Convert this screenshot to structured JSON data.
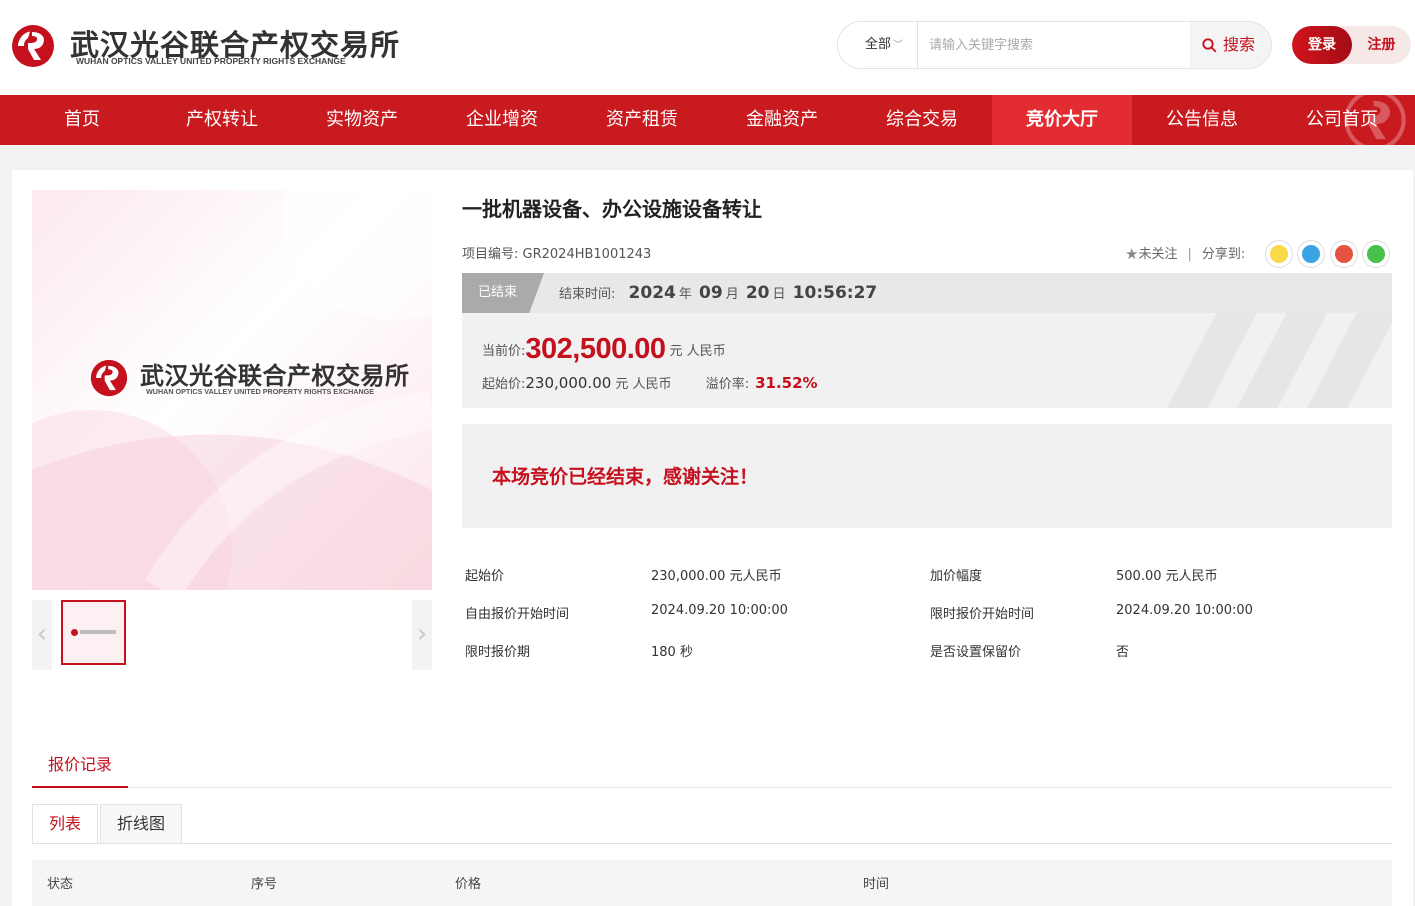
{
  "header": {
    "logo_cn": "武汉光谷联合产权交易所",
    "logo_en": "WUHAN OPTICS VALLEY UNITED PROPERTY RIGHTS EXCHANGE",
    "search": {
      "scope": "全部",
      "placeholder": "请输入关键字搜索",
      "button": "搜索"
    },
    "login": "登录",
    "register": "注册"
  },
  "nav": {
    "items": [
      "首页",
      "产权转让",
      "实物资产",
      "企业增资",
      "资产租赁",
      "金融资产",
      "综合交易",
      "竞价大厅",
      "公告信息",
      "公司首页"
    ],
    "active_index": 7
  },
  "gallery": {
    "image_cn": "武汉光谷联合产权交易所",
    "image_en": "WUHAN OPTICS VALLEY UNITED PROPERTY RIGHTS EXCHANGE",
    "prev": "‹",
    "next": "›"
  },
  "project": {
    "title": "一批机器设备、办公设施设备转让",
    "number_label": "项目编号:",
    "number": "GR2024HB1001243",
    "follow": "未关注",
    "share_label": "分享到:",
    "share_icons": [
      "qzone-icon",
      "qq-icon",
      "weibo-icon",
      "wechat-icon"
    ]
  },
  "auction": {
    "status": "已结束",
    "end_label": "结束时间:",
    "end_year": "2024",
    "year_unit": "年",
    "end_month": "09",
    "month_unit": "月",
    "end_day": "20",
    "day_unit": "日",
    "end_clock": "10:56:27",
    "current_price_label": "当前价:",
    "current_price": "302,500.00",
    "currency": "元 人民币",
    "start_price_label": "起始价:",
    "start_price": "230,000.00",
    "premium_label": "溢价率:",
    "premium_rate": "31.52%",
    "ended_message": "本场竞价已经结束，感谢关注！"
  },
  "specs": [
    {
      "label": "起始价",
      "value": "230,000.00 元人民币"
    },
    {
      "label": "加价幅度",
      "value": "500.00 元人民币"
    },
    {
      "label": "自由报价开始时间",
      "value": "2024.09.20 10:00:00"
    },
    {
      "label": "限时报价开始时间",
      "value": "2024.09.20 10:00:00"
    },
    {
      "label": "限时报价期",
      "value": "180 秒"
    },
    {
      "label": "是否设置保留价",
      "value": "否"
    }
  ],
  "records": {
    "tab": "报价记录",
    "views": [
      "列表",
      "折线图"
    ],
    "columns": [
      "状态",
      "序号",
      "价格",
      "时间"
    ]
  },
  "colors": {
    "brand_red": "#c91a1f",
    "price_red": "#c5101e"
  }
}
